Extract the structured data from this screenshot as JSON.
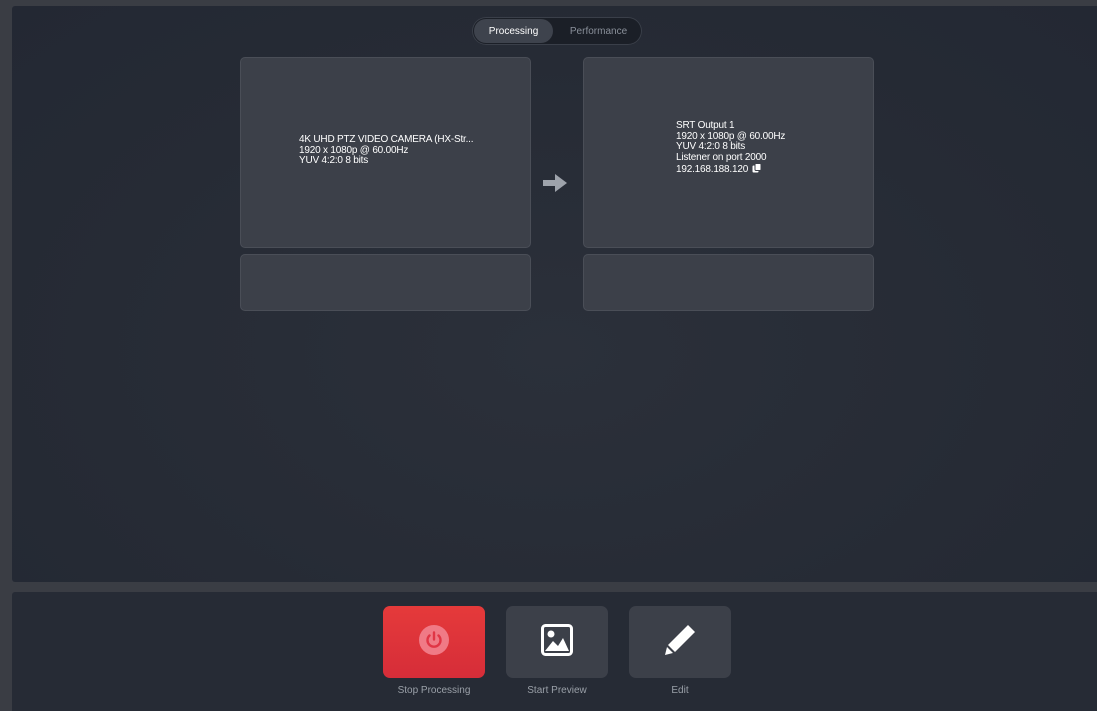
{
  "tabs": {
    "processing": "Processing",
    "performance": "Performance"
  },
  "input": {
    "name": "4K UHD PTZ VIDEO CAMERA (HX-Str...",
    "resolution": "1920 x 1080p @ 60.00Hz",
    "format": "YUV 4:2:0 8 bits"
  },
  "output": {
    "name": "SRT Output 1",
    "resolution": "1920 x 1080p @ 60.00Hz",
    "format": "YUV 4:2:0 8 bits",
    "listener": "Listener  on port 2000",
    "ip": "192.168.188.120"
  },
  "actions": {
    "stop": "Stop Processing",
    "preview": "Start Preview",
    "edit": "Edit"
  },
  "icons": {
    "flow": "arrow-right-icon",
    "copy": "copy-icon",
    "stop": "power-icon",
    "preview": "image-icon",
    "edit": "pencil-icon"
  },
  "colors": {
    "accent_stop": "#e53a3a",
    "panel_bg": "#262b35",
    "card_bg": "#3c4049"
  }
}
